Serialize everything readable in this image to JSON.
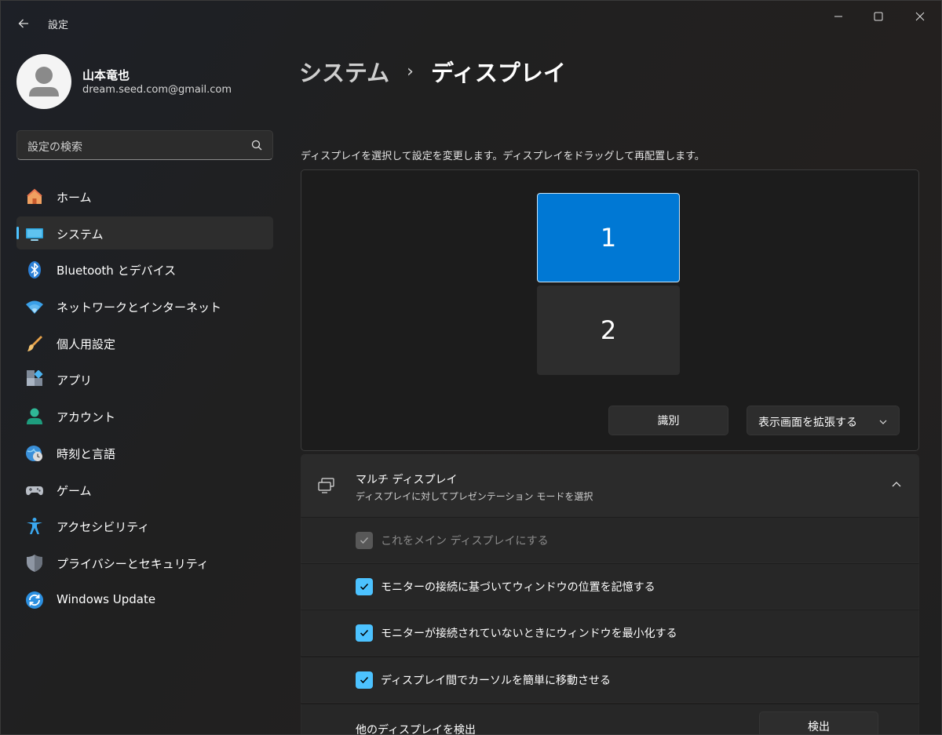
{
  "app": {
    "title": "設定"
  },
  "user": {
    "name": "山本竜也",
    "email": "dream.seed.com@gmail.com"
  },
  "search": {
    "placeholder": "設定の検索"
  },
  "nav": {
    "items": [
      {
        "label": "ホーム",
        "icon": "home-icon"
      },
      {
        "label": "システム",
        "icon": "system-icon",
        "active": true
      },
      {
        "label": "Bluetooth とデバイス",
        "icon": "bluetooth-icon"
      },
      {
        "label": "ネットワークとインターネット",
        "icon": "wifi-icon"
      },
      {
        "label": "個人用設定",
        "icon": "brush-icon"
      },
      {
        "label": "アプリ",
        "icon": "apps-icon"
      },
      {
        "label": "アカウント",
        "icon": "account-icon"
      },
      {
        "label": "時刻と言語",
        "icon": "globe-clock-icon"
      },
      {
        "label": "ゲーム",
        "icon": "gamepad-icon"
      },
      {
        "label": "アクセシビリティ",
        "icon": "accessibility-icon"
      },
      {
        "label": "プライバシーとセキュリティ",
        "icon": "shield-icon"
      },
      {
        "label": "Windows Update",
        "icon": "update-icon"
      }
    ]
  },
  "breadcrumb": {
    "parent": "システム",
    "separator": "›",
    "current": "ディスプレイ"
  },
  "display": {
    "hint": "ディスプレイを選択して設定を変更します。ディスプレイをドラッグして再配置します。",
    "monitor_1": "1",
    "monitor_2": "2",
    "identify_label": "識別",
    "mode_label": "表示画面を拡張する"
  },
  "multi_display": {
    "title": "マルチ ディスプレイ",
    "subtitle": "ディスプレイに対してプレゼンテーション モードを選択",
    "options": [
      {
        "label": "これをメイン ディスプレイにする",
        "checked": true,
        "disabled": true
      },
      {
        "label": "モニターの接続に基づいてウィンドウの位置を記憶する",
        "checked": true,
        "disabled": false
      },
      {
        "label": "モニターが接続されていないときにウィンドウを最小化する",
        "checked": true,
        "disabled": false
      },
      {
        "label": "ディスプレイ間でカーソルを簡単に移動させる",
        "checked": true,
        "disabled": false
      }
    ],
    "detect_label": "他のディスプレイを検出",
    "detect_button": "検出"
  },
  "colors": {
    "accent": "#4cc2ff",
    "selected_monitor": "#0078d4",
    "background": "#202020"
  }
}
